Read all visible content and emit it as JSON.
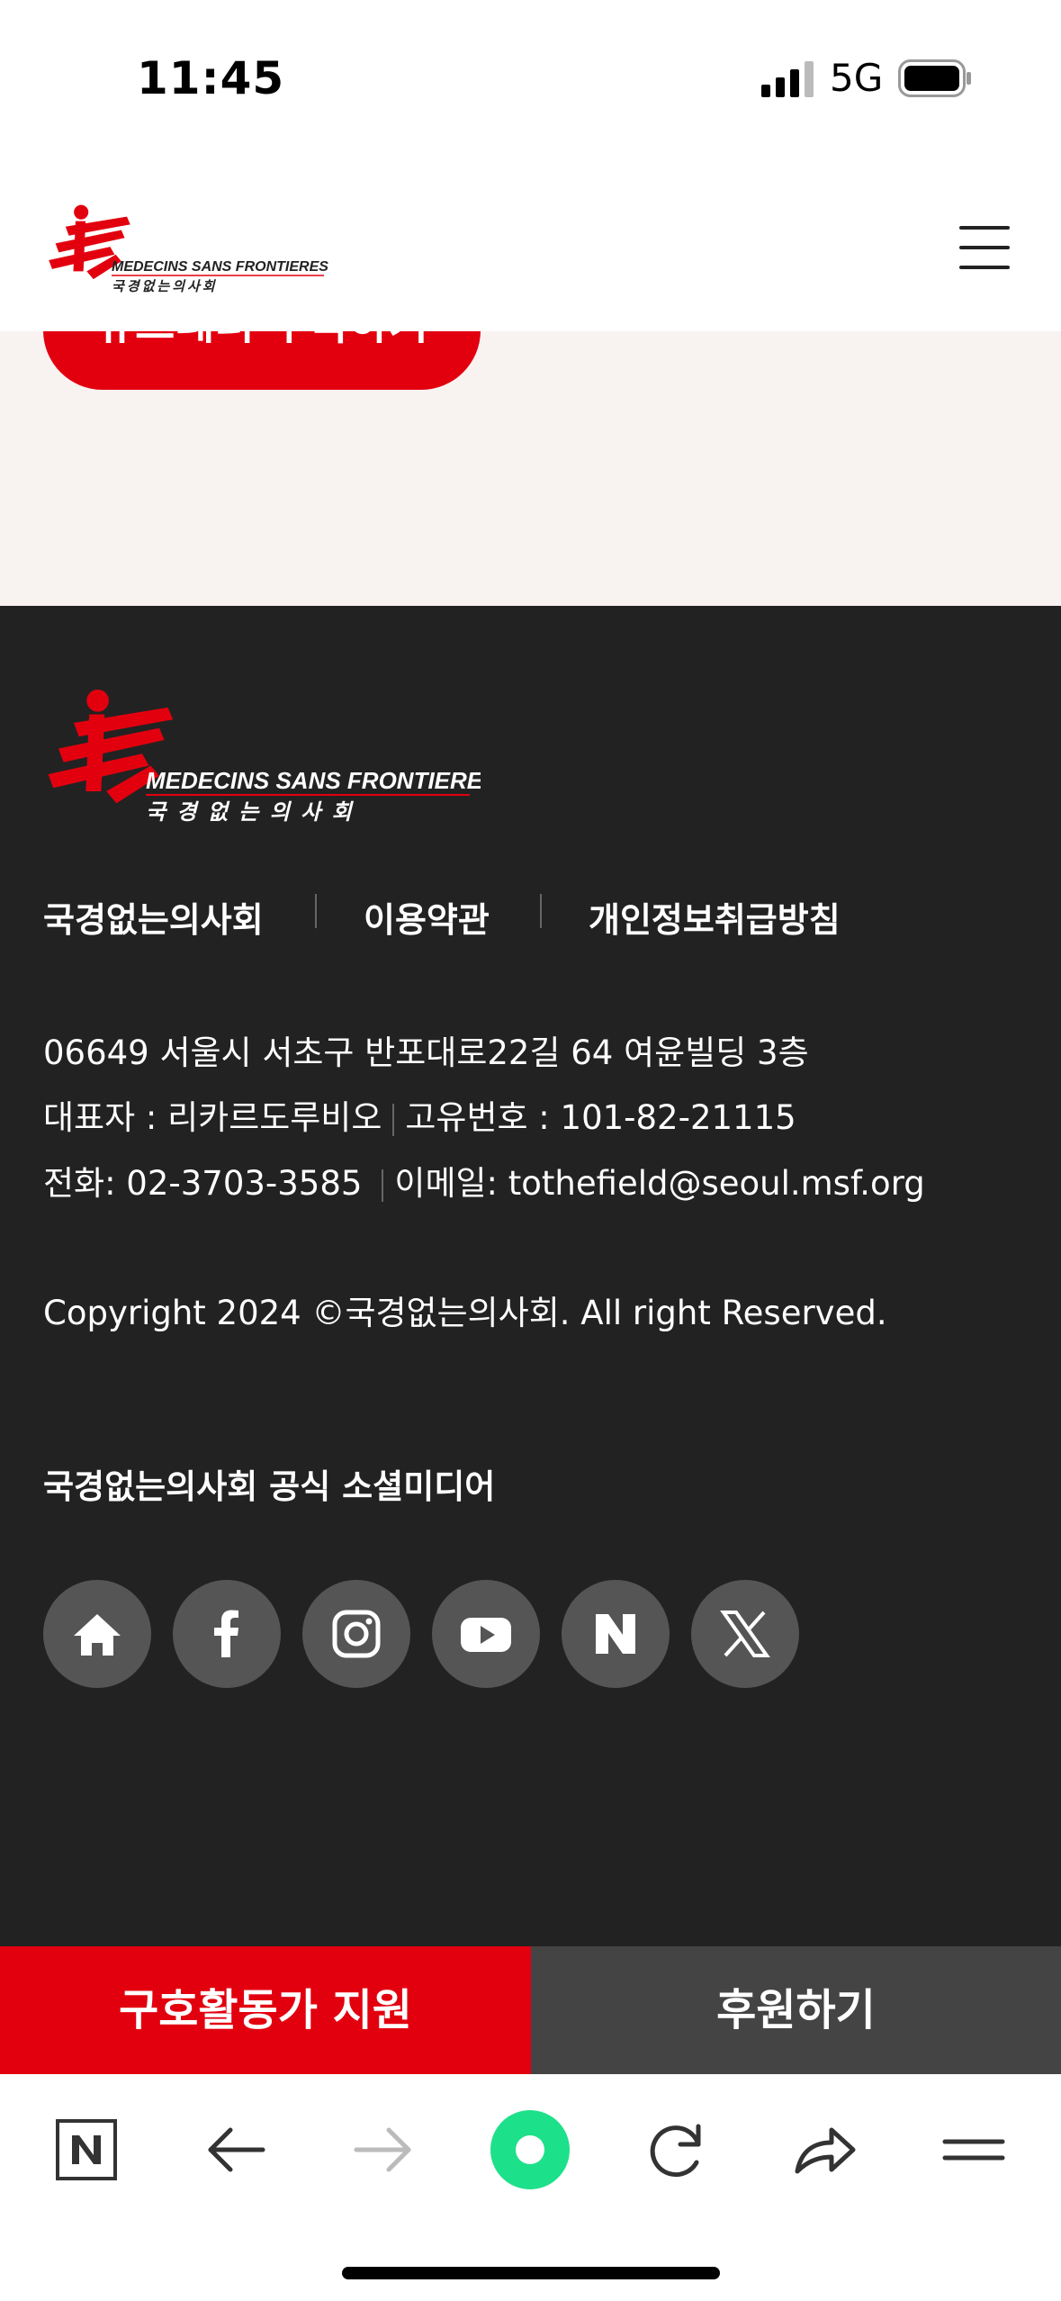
{
  "status_bar": {
    "time": "11:45",
    "network": "5G"
  },
  "header": {
    "logo_name_en": "MEDECINS SANS FRONTIERES",
    "logo_name_ko": "국경없는의사회",
    "menu_icon": "hamburger-icon"
  },
  "pink_section": {
    "button_label": "뉴스레터 구독하기"
  },
  "footer": {
    "logo_name_en": "MEDECINS SANS FRONTIERES",
    "logo_name_ko": "국 경 없 는 의 사 회",
    "links": [
      "국경없는의사회",
      "이용약관",
      "개인정보취급방침"
    ],
    "address": "06649 서울시 서초구 반포대로22길 64 여윤빌딩 3층",
    "representative": "대표자 : 리카르도루비오",
    "business_no": "고유번호 : 101-82-21115",
    "phone": "전화: 02-3703-3585",
    "email": "이메일: tothefield@seoul.msf.org",
    "copyright": "Copyright 2024 ©국경없는의사회. All right Reserved.",
    "social_title": "국경없는의사회 공식 소셜미디어",
    "social_icons": [
      "home-icon",
      "facebook-icon",
      "instagram-icon",
      "youtube-icon",
      "naver-icon",
      "x-icon"
    ]
  },
  "cta": {
    "left_label": "구호활동가 지원",
    "right_label": "후원하기"
  },
  "toolbar": {
    "icons": [
      "naver-tab-icon",
      "back-arrow-icon",
      "forward-arrow-icon",
      "green-dot-icon",
      "reload-icon",
      "share-icon",
      "menu-icon"
    ]
  },
  "colors": {
    "brand_red": "#e2000f",
    "footer_bg": "#222222",
    "social_bg": "#555555",
    "pink_bg": "#f8f2f1",
    "green": "#1de08a"
  }
}
